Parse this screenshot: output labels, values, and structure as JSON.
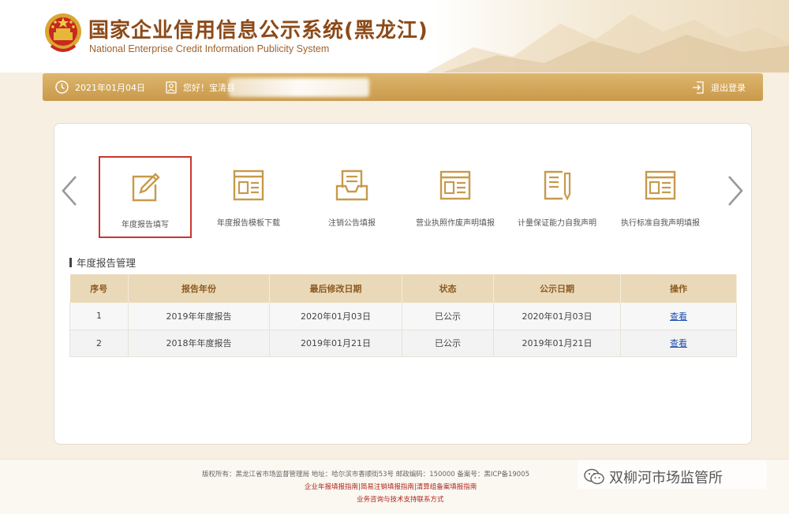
{
  "header": {
    "title": "国家企业信用信息公示系统(黑龙江)",
    "subtitle": "National Enterprise Credit Information Publicity System"
  },
  "userbar": {
    "date": "2021年01月04日",
    "greeting": "您好！宝清县",
    "logout_label": "退出登录"
  },
  "functions": [
    {
      "label": "年度报告填写",
      "icon": "edit-icon",
      "selected": true
    },
    {
      "label": "年度报告模板下载",
      "icon": "template-icon"
    },
    {
      "label": "注销公告填报",
      "icon": "inbox-icon"
    },
    {
      "label": "营业执照作废声明填报",
      "icon": "license-icon"
    },
    {
      "label": "计量保证能力自我声明",
      "icon": "document-pen-icon"
    },
    {
      "label": "执行标准自我声明填报",
      "icon": "standard-icon"
    }
  ],
  "section": {
    "title": "年度报告管理"
  },
  "table": {
    "headers": [
      "序号",
      "报告年份",
      "最后修改日期",
      "状态",
      "公示日期",
      "操作"
    ],
    "rows": [
      {
        "no": "1",
        "year": "2019年年度报告",
        "modified": "2020年01月03日",
        "status": "已公示",
        "published": "2020年01月03日",
        "action": "查看"
      },
      {
        "no": "2",
        "year": "2018年年度报告",
        "modified": "2019年01月21日",
        "status": "已公示",
        "published": "2019年01月21日",
        "action": "查看"
      }
    ]
  },
  "footer": {
    "copyright": "版权所有：黑龙江省市场监督管理局 地址：哈尔滨市香顺街53号 邮政编码：150000 备案号：黑ICP备19005",
    "guide_links": "企业年报填报指南|简易注销填报指南|清算组备案填报指南",
    "support": "业务咨询与技术支持联系方式"
  },
  "watermark": "双柳河市场监管所",
  "colors": {
    "gold": "#c9994b",
    "brown_title": "#8c4a18",
    "selected_border": "#c9362e",
    "link": "#1f4fb0"
  }
}
